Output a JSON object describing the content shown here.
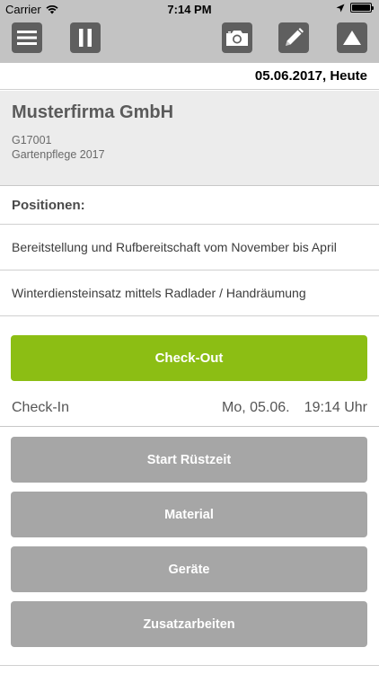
{
  "status_bar": {
    "carrier": "Carrier",
    "time": "7:14 PM",
    "icons": [
      "wifi-icon",
      "location-arrow-icon",
      "battery-icon"
    ]
  },
  "toolbar": {
    "buttons": [
      {
        "name": "menu",
        "icon": "hamburger-icon"
      },
      {
        "name": "pause",
        "icon": "pause-icon"
      },
      {
        "name": "camera",
        "icon": "camera-icon"
      },
      {
        "name": "edit",
        "icon": "pencil-icon"
      },
      {
        "name": "up",
        "icon": "triangle-up-icon"
      }
    ]
  },
  "date_header": "05.06.2017, Heute",
  "company": {
    "name": "Musterfirma GmbH",
    "code": "G17001",
    "project": "Gartenpflege 2017"
  },
  "positions": {
    "title": "Positionen:",
    "items": [
      "Bereitstellung und Rufbereitschaft vom November bis April",
      "Winterdiensteinsatz mittels Radlader / Handräumung"
    ]
  },
  "checkout_label": "Check-Out",
  "checkin": {
    "label": "Check-In",
    "date": "Mo, 05.06.",
    "time": "19:14 Uhr"
  },
  "actions": [
    "Start Rüstzeit",
    "Material",
    "Geräte",
    "Zusatzarbeiten"
  ],
  "colors": {
    "toolbar_bg": "#c3c3c3",
    "icon_button_bg": "#5f5f5f",
    "checkout_green": "#8cbe14",
    "action_grey": "#a6a6a6",
    "company_bg": "#ececec"
  }
}
